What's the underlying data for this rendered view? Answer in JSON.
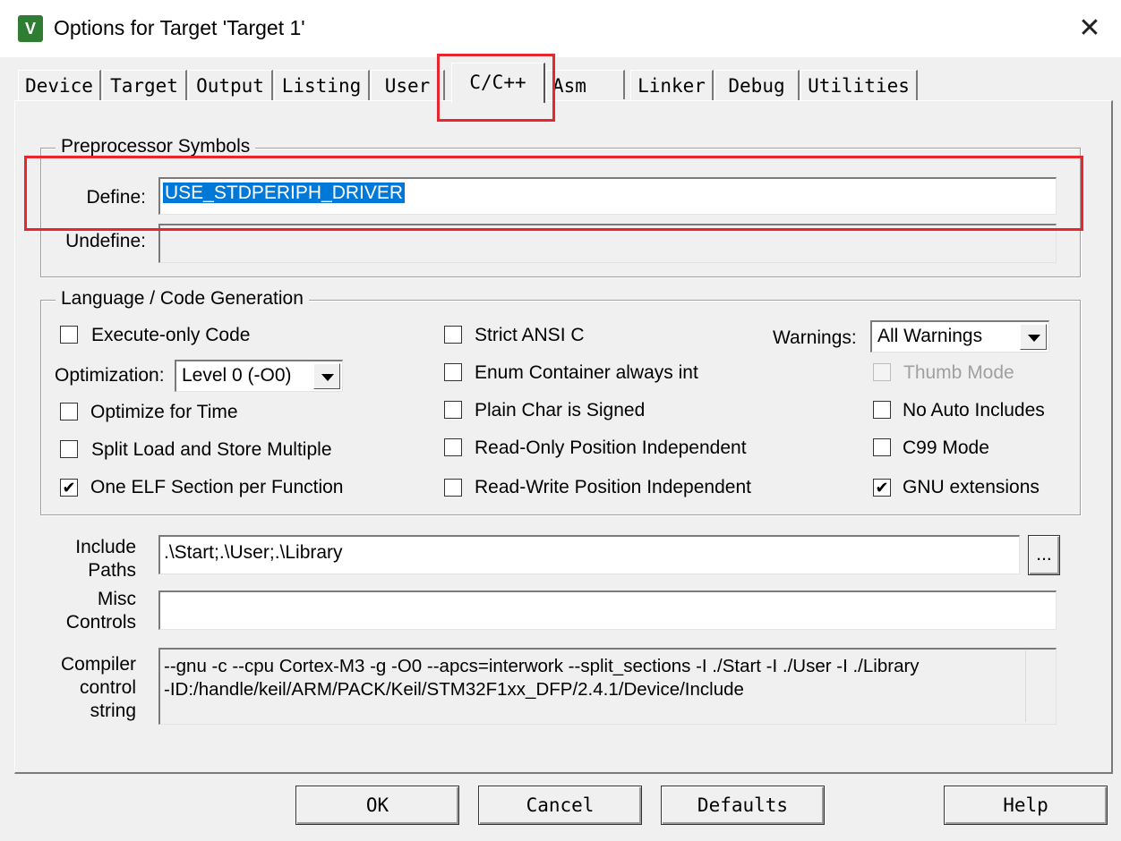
{
  "window": {
    "title": "Options for Target 'Target 1'",
    "app_icon": "keil-v5-icon",
    "close_glyph": "✕"
  },
  "tabs": [
    {
      "label": "Device"
    },
    {
      "label": "Target"
    },
    {
      "label": "Output"
    },
    {
      "label": "Listing"
    },
    {
      "label": "User"
    },
    {
      "label": "C/C++",
      "active": true
    },
    {
      "label": "Asm"
    },
    {
      "label": "Linker"
    },
    {
      "label": "Debug"
    },
    {
      "label": "Utilities"
    }
  ],
  "preprocessor": {
    "legend": "Preprocessor Symbols",
    "define_label": "Define:",
    "define_value": "USE_STDPERIPH_DRIVER",
    "undefine_label": "Undefine:",
    "undefine_value": ""
  },
  "language": {
    "legend": "Language / Code Generation",
    "execute_only": {
      "label": "Execute-only Code",
      "checked": false
    },
    "optimization_label": "Optimization:",
    "optimization_value": "Level 0 (-O0)",
    "optimize_time": {
      "label": "Optimize for Time",
      "checked": false
    },
    "split_load": {
      "label": "Split Load and Store Multiple",
      "checked": false
    },
    "one_elf": {
      "label": "One ELF Section per Function",
      "checked": true
    },
    "strict_ansi": {
      "label": "Strict ANSI C",
      "checked": false
    },
    "enum_container": {
      "label": "Enum Container always int",
      "checked": false
    },
    "plain_char": {
      "label": "Plain Char is Signed",
      "checked": false
    },
    "ro_pi": {
      "label": "Read-Only Position Independent",
      "checked": false
    },
    "rw_pi": {
      "label": "Read-Write Position Independent",
      "checked": false
    },
    "warnings_label": "Warnings:",
    "warnings_value": "All Warnings",
    "thumb_mode": {
      "label": "Thumb Mode",
      "checked": false,
      "disabled": true
    },
    "no_auto_includes": {
      "label": "No Auto Includes",
      "checked": false
    },
    "c99_mode": {
      "label": "C99 Mode",
      "checked": false
    },
    "gnu_extensions": {
      "label": "GNU extensions",
      "checked": true
    }
  },
  "include_paths": {
    "label_line1": "Include",
    "label_line2": "Paths",
    "value": ".\\Start;.\\User;.\\Library",
    "browse_label": "..."
  },
  "misc_controls": {
    "label_line1": "Misc",
    "label_line2": "Controls",
    "value": ""
  },
  "compiler_string": {
    "label_line1": "Compiler",
    "label_line2": "control",
    "label_line3": "string",
    "line1": "--gnu -c --cpu Cortex-M3 -g -O0 --apcs=interwork --split_sections -I ./Start -I ./User -I ./Library",
    "line2": "-ID:/handle/keil/ARM/PACK/Keil/STM32F1xx_DFP/2.4.1/Device/Include"
  },
  "buttons": {
    "ok": "OK",
    "cancel": "Cancel",
    "defaults": "Defaults",
    "help": "Help"
  },
  "annotation_color": "#e8262d",
  "check_glyph": "✔"
}
